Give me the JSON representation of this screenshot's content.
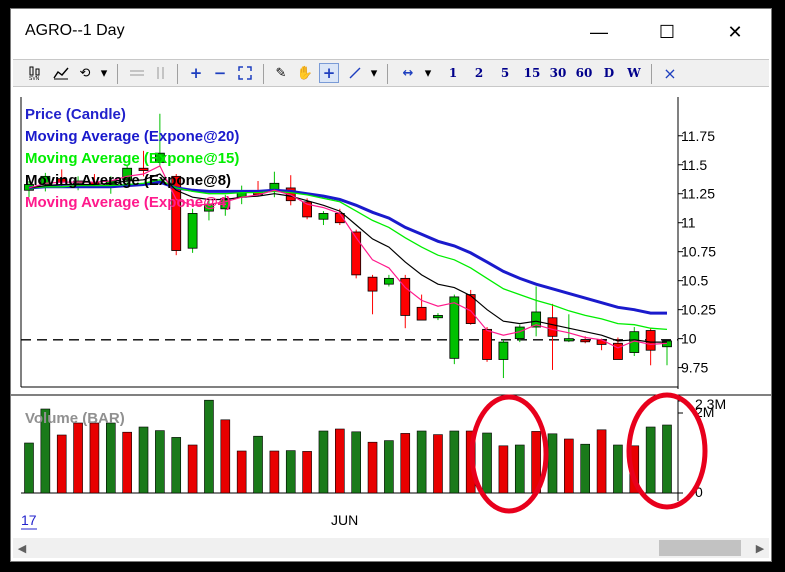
{
  "window": {
    "title": "AGRO--1 Day",
    "minimize_glyph": "—",
    "maximize_glyph": "☐",
    "close_glyph": "✕"
  },
  "toolbar": {
    "icons": [
      "svn-chart-icon",
      "line-chart-icon",
      "refresh-icon",
      "dropdown-icon",
      "single-pane-icon",
      "dual-pane-icon",
      "zoom-in-icon",
      "zoom-out-icon",
      "fit-icon",
      "draw-icon",
      "pan-hand-icon",
      "crosshair-icon",
      "line-tool-icon",
      "dropdown-icon",
      "scroll-icon",
      "dropdown-icon",
      "close-icon"
    ],
    "zoom_in": "+",
    "zoom_out": "−",
    "crosshair": "+",
    "periods": [
      "1",
      "2",
      "5",
      "15",
      "30",
      "60",
      "D",
      "W"
    ],
    "close": "×"
  },
  "legend": [
    {
      "label": "Price (Candle)",
      "color": "#2222cc"
    },
    {
      "label": "Moving Average (Expone@20)",
      "color": "#1a1acc"
    },
    {
      "label": "Moving Average (Expone@15)",
      "color": "#00ee00"
    },
    {
      "label": "Moving Average (Expone@8)",
      "color": "#000000"
    },
    {
      "label": "Moving Average (Expone@4)",
      "color": "#ff1a8c"
    }
  ],
  "volume_label": "Volume (BAR)",
  "x_labels": {
    "left": "17",
    "mid": "JUN"
  },
  "chart_data": [
    {
      "type": "candlestick",
      "title": "",
      "y_ticks": [
        "11.75",
        "11.5",
        "11.25",
        "11",
        "10.75",
        "10.5",
        "10.25",
        "10",
        "9.75"
      ],
      "y_tick_values": [
        11.75,
        11.5,
        11.25,
        11,
        10.75,
        10.5,
        10.25,
        10,
        9.75
      ],
      "ylim": [
        9.6,
        12.05
      ],
      "dashed_line_value": 9.99,
      "candles": [
        {
          "o": 11.28,
          "h": 11.36,
          "l": 11.22,
          "c": 11.33
        },
        {
          "o": 11.33,
          "h": 11.43,
          "l": 11.27,
          "c": 11.4
        },
        {
          "o": 11.38,
          "h": 11.46,
          "l": 11.32,
          "c": 11.35
        },
        {
          "o": 11.34,
          "h": 11.4,
          "l": 11.28,
          "c": 11.36
        },
        {
          "o": 11.35,
          "h": 11.42,
          "l": 11.3,
          "c": 11.33
        },
        {
          "o": 11.33,
          "h": 11.4,
          "l": 11.25,
          "c": 11.36
        },
        {
          "o": 11.37,
          "h": 11.5,
          "l": 11.32,
          "c": 11.47
        },
        {
          "o": 11.47,
          "h": 11.62,
          "l": 11.4,
          "c": 11.45
        },
        {
          "o": 11.52,
          "h": 11.94,
          "l": 11.48,
          "c": 11.6
        },
        {
          "o": 11.4,
          "h": 11.42,
          "l": 10.72,
          "c": 10.76
        },
        {
          "o": 10.78,
          "h": 11.12,
          "l": 10.74,
          "c": 11.08
        },
        {
          "o": 11.1,
          "h": 11.2,
          "l": 11.02,
          "c": 11.16
        },
        {
          "o": 11.12,
          "h": 11.24,
          "l": 11.06,
          "c": 11.21
        },
        {
          "o": 11.22,
          "h": 11.32,
          "l": 11.16,
          "c": 11.26
        },
        {
          "o": 11.26,
          "h": 11.36,
          "l": 11.24,
          "c": 11.25
        },
        {
          "o": 11.27,
          "h": 11.44,
          "l": 11.22,
          "c": 11.34
        },
        {
          "o": 11.3,
          "h": 11.41,
          "l": 11.15,
          "c": 11.19
        },
        {
          "o": 11.18,
          "h": 11.21,
          "l": 11.03,
          "c": 11.05
        },
        {
          "o": 11.03,
          "h": 11.1,
          "l": 10.98,
          "c": 11.08
        },
        {
          "o": 11.08,
          "h": 11.12,
          "l": 10.98,
          "c": 11.0
        },
        {
          "o": 10.92,
          "h": 10.94,
          "l": 10.52,
          "c": 10.55
        },
        {
          "o": 10.53,
          "h": 10.55,
          "l": 10.21,
          "c": 10.41
        },
        {
          "o": 10.47,
          "h": 10.55,
          "l": 10.45,
          "c": 10.52
        },
        {
          "o": 10.52,
          "h": 10.55,
          "l": 10.09,
          "c": 10.2
        },
        {
          "o": 10.27,
          "h": 10.38,
          "l": 10.18,
          "c": 10.16
        },
        {
          "o": 10.18,
          "h": 10.22,
          "l": 10.16,
          "c": 10.2
        },
        {
          "o": 9.83,
          "h": 10.38,
          "l": 9.78,
          "c": 10.36
        },
        {
          "o": 10.38,
          "h": 10.42,
          "l": 10.12,
          "c": 10.13
        },
        {
          "o": 10.08,
          "h": 10.1,
          "l": 9.8,
          "c": 9.82
        },
        {
          "o": 9.82,
          "h": 9.99,
          "l": 9.66,
          "c": 9.97
        },
        {
          "o": 10.0,
          "h": 10.12,
          "l": 9.97,
          "c": 10.1
        },
        {
          "o": 10.1,
          "h": 10.45,
          "l": 10.02,
          "c": 10.23
        },
        {
          "o": 10.18,
          "h": 10.3,
          "l": 9.73,
          "c": 10.02
        },
        {
          "o": 9.98,
          "h": 10.21,
          "l": 9.97,
          "c": 10.0
        },
        {
          "o": 9.99,
          "h": 10.02,
          "l": 9.96,
          "c": 9.98
        },
        {
          "o": 9.99,
          "h": 10.0,
          "l": 9.9,
          "c": 9.95
        },
        {
          "o": 9.96,
          "h": 10.01,
          "l": 9.82,
          "c": 9.82
        },
        {
          "o": 9.88,
          "h": 10.1,
          "l": 9.85,
          "c": 10.06
        },
        {
          "o": 10.07,
          "h": 10.09,
          "l": 9.77,
          "c": 9.9
        },
        {
          "o": 9.93,
          "h": 9.98,
          "l": 9.77,
          "c": 9.98
        }
      ],
      "ema20": [
        11.3,
        11.31,
        11.31,
        11.31,
        11.31,
        11.31,
        11.32,
        11.33,
        11.35,
        11.3,
        11.28,
        11.27,
        11.27,
        11.27,
        11.27,
        11.28,
        11.27,
        11.25,
        11.23,
        11.2,
        11.15,
        11.09,
        11.04,
        10.96,
        10.9,
        10.84,
        10.8,
        10.74,
        10.66,
        10.58,
        10.52,
        10.47,
        10.43,
        10.39,
        10.35,
        10.31,
        10.27,
        10.25,
        10.22,
        10.22
      ],
      "ema15": [
        11.3,
        11.31,
        11.31,
        11.32,
        11.32,
        11.32,
        11.33,
        11.34,
        11.37,
        11.3,
        11.27,
        11.25,
        11.25,
        11.26,
        11.26,
        11.27,
        11.26,
        11.24,
        11.21,
        11.18,
        11.1,
        11.02,
        10.96,
        10.87,
        10.79,
        10.72,
        10.68,
        10.61,
        10.52,
        10.43,
        10.38,
        10.33,
        10.29,
        10.24,
        10.2,
        10.17,
        10.13,
        10.12,
        10.09,
        10.08
      ],
      "ema8": [
        11.3,
        11.32,
        11.33,
        11.33,
        11.33,
        11.34,
        11.36,
        11.37,
        11.42,
        11.28,
        11.22,
        11.2,
        11.2,
        11.22,
        11.23,
        11.25,
        11.23,
        11.19,
        11.15,
        11.1,
        10.98,
        10.86,
        10.79,
        10.66,
        10.55,
        10.47,
        10.44,
        10.37,
        10.25,
        10.15,
        10.13,
        10.15,
        10.12,
        10.09,
        10.06,
        10.03,
        9.98,
        9.99,
        9.97,
        9.97
      ],
      "ema4": [
        11.3,
        11.34,
        11.35,
        11.35,
        11.35,
        11.36,
        11.4,
        11.42,
        11.49,
        11.2,
        11.15,
        11.16,
        11.18,
        11.22,
        11.24,
        11.28,
        11.24,
        11.16,
        11.13,
        11.08,
        10.87,
        10.68,
        10.61,
        10.44,
        10.33,
        10.28,
        10.31,
        10.24,
        10.07,
        10.03,
        10.06,
        10.12,
        10.08,
        10.05,
        10.01,
        9.99,
        9.92,
        9.98,
        9.95,
        9.96
      ]
    },
    {
      "type": "bar",
      "title": "Volume (BAR)",
      "y_ticks": [
        "2.3M",
        "2M",
        "0"
      ],
      "y_tick_values": [
        2300000,
        2000000,
        0
      ],
      "ylim": [
        0,
        2300000
      ],
      "values": [
        1250000,
        2100000,
        1450000,
        1750000,
        1750000,
        1750000,
        1520000,
        1650000,
        1560000,
        1390000,
        1200000,
        2320000,
        1830000,
        1050000,
        1420000,
        1050000,
        1060000,
        1040000,
        1550000,
        1600000,
        1530000,
        1270000,
        1310000,
        1490000,
        1550000,
        1460000,
        1550000,
        1550000,
        1500000,
        1180000,
        1200000,
        1540000,
        1480000,
        1350000,
        1220000,
        1580000,
        1200000,
        1180000,
        1650000,
        1700000
      ],
      "colors": [
        "green",
        "green",
        "red",
        "red",
        "red",
        "green",
        "red",
        "green",
        "green",
        "green",
        "red",
        "green",
        "red",
        "red",
        "green",
        "red",
        "green",
        "red",
        "green",
        "red",
        "green",
        "red",
        "green",
        "red",
        "green",
        "red",
        "green",
        "red",
        "green",
        "red",
        "green",
        "red",
        "green",
        "red",
        "green",
        "red",
        "green",
        "red",
        "green",
        "green"
      ]
    }
  ],
  "annotations": [
    {
      "type": "ellipse",
      "color": "#e8001c",
      "target": "volume-spike-1"
    },
    {
      "type": "ellipse",
      "color": "#e8001c",
      "target": "volume-spike-2"
    }
  ]
}
